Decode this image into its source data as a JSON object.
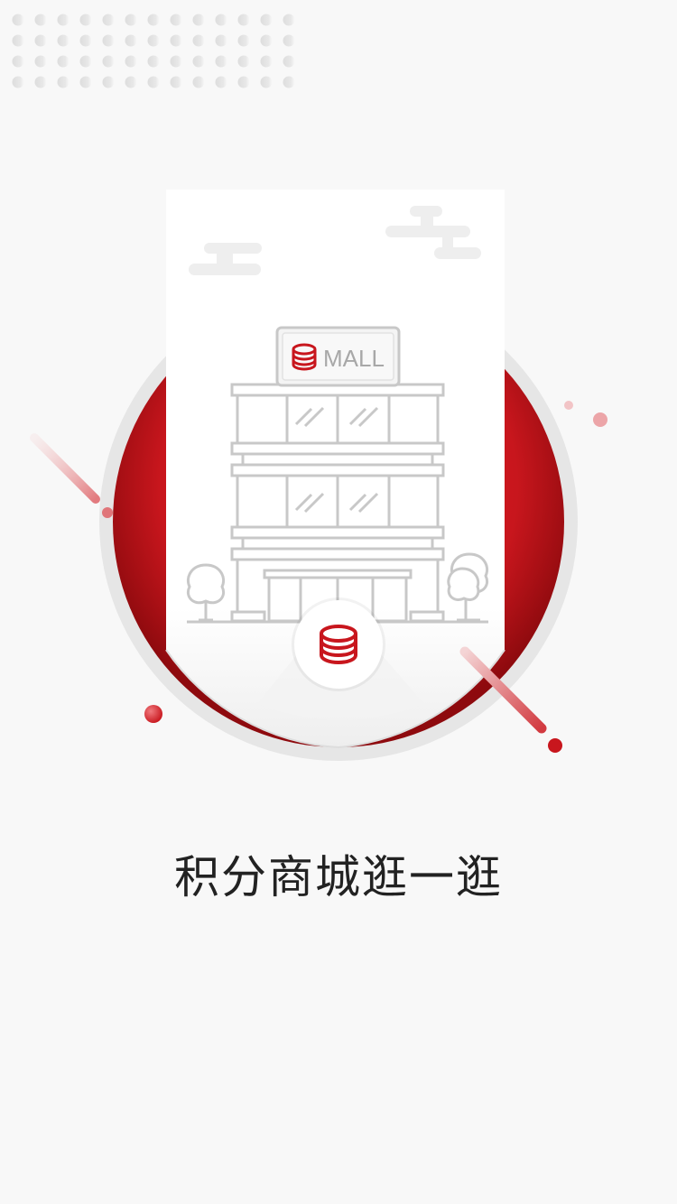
{
  "onboarding": {
    "sign_text": "MALL",
    "caption": "积分商城逛一逛"
  },
  "colors": {
    "accent": "#c8161d",
    "background": "#f8f8f8",
    "line_art": "#c8c8c8"
  },
  "icons": {
    "sign": "coin-stack-icon",
    "badge": "coin-stack-icon"
  }
}
